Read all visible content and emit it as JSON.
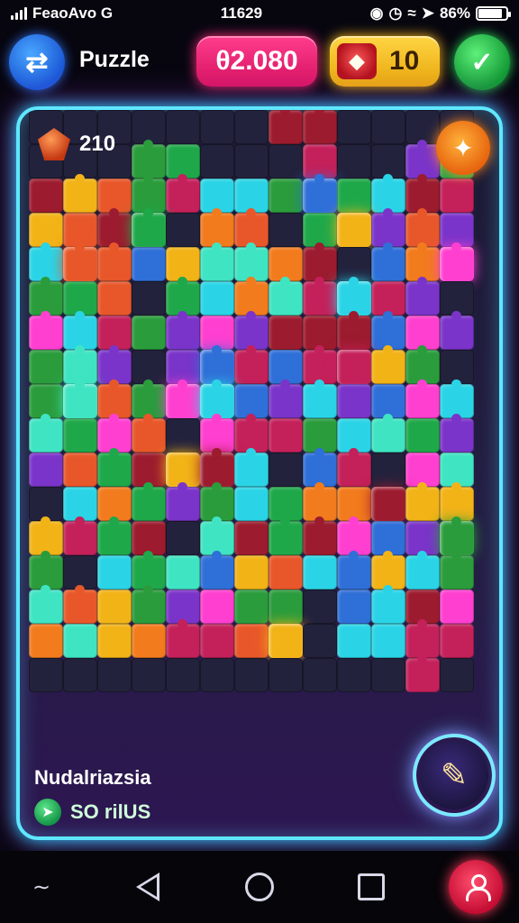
{
  "status_bar": {
    "carrier": "FeaoAv​o G",
    "time": "11629",
    "battery_text": "86%",
    "icons": [
      "signal-icon",
      "alarm-icon",
      "clock-icon",
      "wifi-icon",
      "location-icon",
      "battery-icon"
    ]
  },
  "header": {
    "back_icon": "cart-back-icon",
    "title": "Puzzle",
    "score": "θ2.080",
    "coins": "10",
    "gift_icon": "gift-icon",
    "confirm_icon": "check-heart-icon"
  },
  "board": {
    "gem_icon": "gem-icon",
    "gem_count": "210",
    "hint_icon": "magic-wand-icon",
    "puzzle_name": "Nudalriazsia",
    "bonus_text": "SO rilUS",
    "bonus_icon": "arrow-icon",
    "edit_icon": "pencil-icon",
    "palette": [
      "#e8572a",
      "#f2b317",
      "#1fa84a",
      "#2ad4e6",
      "#7a34c9",
      "#c4205a",
      "#2f6fd8",
      "#9c1b2e",
      "#ff3fd0",
      "#f27b1d",
      "#3fe4c2",
      "#2a9c3c"
    ]
  },
  "nav_bar": {
    "items": [
      "back-gesture-icon",
      "back-triangle-icon",
      "home-circle-icon",
      "recents-square-icon",
      "profile-icon"
    ]
  },
  "colors": {
    "frame_glow": "#5fe7ff",
    "score_pill": "#ff3d8d",
    "coins_pill": "#ffd544",
    "confirm_green": "#1fbf4a",
    "back_blue": "#2f6ee8"
  }
}
